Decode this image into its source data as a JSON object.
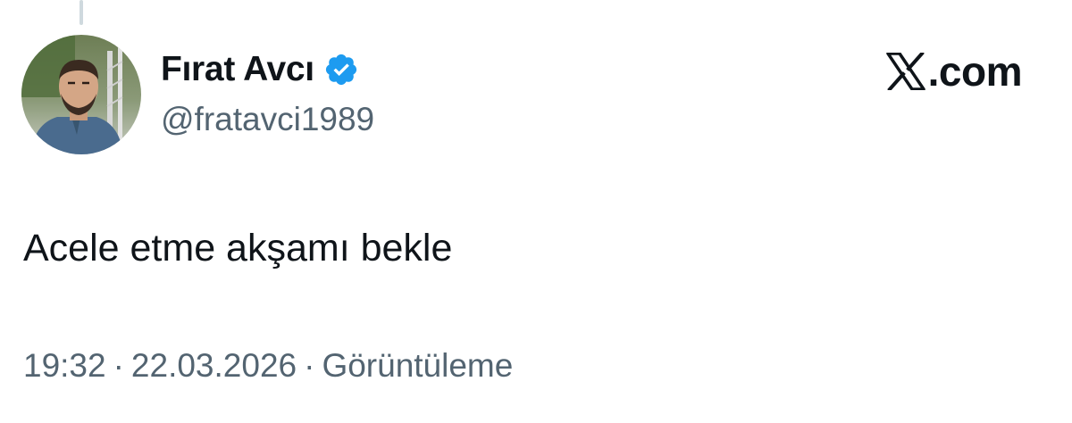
{
  "author": {
    "display_name": "Fırat Avcı",
    "handle": "@fratavci1989",
    "verified_icon": "verified-badge",
    "verified_color": "#1d9bf0"
  },
  "brand": {
    "icon": "x-logo",
    "text": ".com"
  },
  "post": {
    "text": "Acele etme akşamı bekle"
  },
  "meta": {
    "time": "19:32",
    "separator": "·",
    "date": "22.03.2026",
    "views_label": "Görüntüleme"
  },
  "colors": {
    "text_primary": "#0f1419",
    "text_secondary": "#536471",
    "thread_line": "#cfd9de",
    "background": "#ffffff"
  }
}
